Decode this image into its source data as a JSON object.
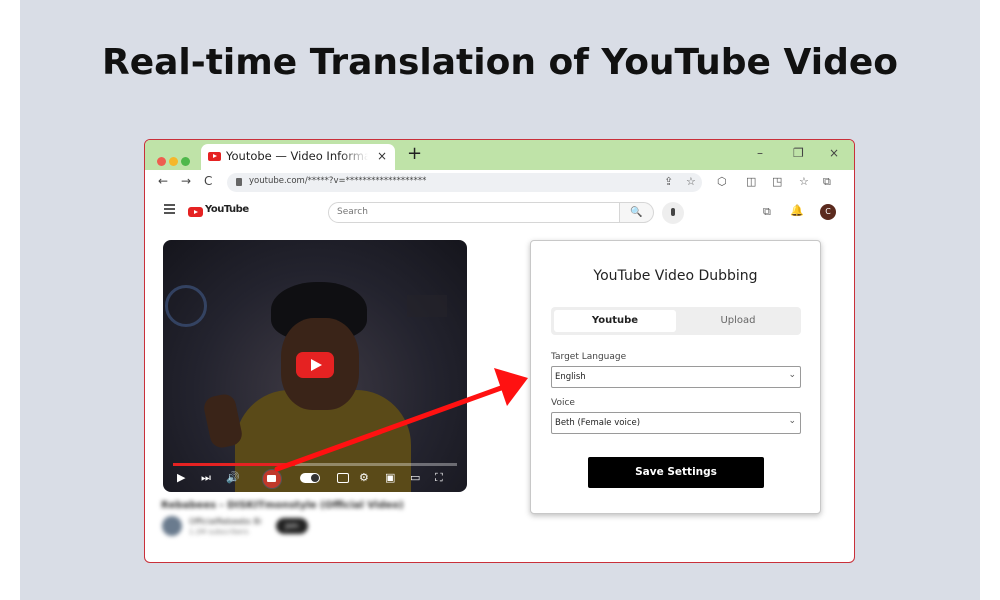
{
  "headline": "Real-time Translation of YouTube Video",
  "browser": {
    "tab_title": "Youtobe — Video Information",
    "tab_close": "×",
    "new_tab": "+",
    "window_controls": {
      "minimize": "–",
      "restore": "❐",
      "close": "×"
    },
    "nav": {
      "back": "←",
      "forward": "→",
      "reload": "C"
    },
    "url": "youtube.com/*****?v=*******************",
    "toolbar_icons": [
      "⇪",
      "☆",
      "⬡",
      "◫",
      "◳",
      "☆",
      "⧉",
      "☺"
    ]
  },
  "youtube": {
    "logo_text": "YouTube",
    "search_placeholder": "Search",
    "search_icon": "🔍",
    "avatar_initial": "C",
    "header_icons": [
      "⧉",
      "🔔"
    ],
    "video_title": "Rebabees - DISKITmonstyle (Official Video)",
    "channel_name": "OfficialRebeebs Bi",
    "channel_subs": "1.2M subscribers",
    "join_label": "Join",
    "progress_percent": 43,
    "player_controls": [
      "▶",
      "⏭",
      "🔊",
      "⚙",
      "▣",
      "▭",
      "⛶"
    ]
  },
  "panel": {
    "title": "YouTube Video Dubbing",
    "tabs": [
      {
        "label": "Youtube",
        "active": true
      },
      {
        "label": "Upload",
        "active": false
      }
    ],
    "target_language_label": "Target Language",
    "target_language_value": "English",
    "voice_label": "Voice",
    "voice_value": "Beth (Female voice)",
    "save_label": "Save Settings"
  },
  "colors": {
    "accent_red": "#e52222",
    "tabbar_green": "#bfe3a8",
    "border_red": "#c9303a",
    "arrow_red": "#ff1111"
  }
}
